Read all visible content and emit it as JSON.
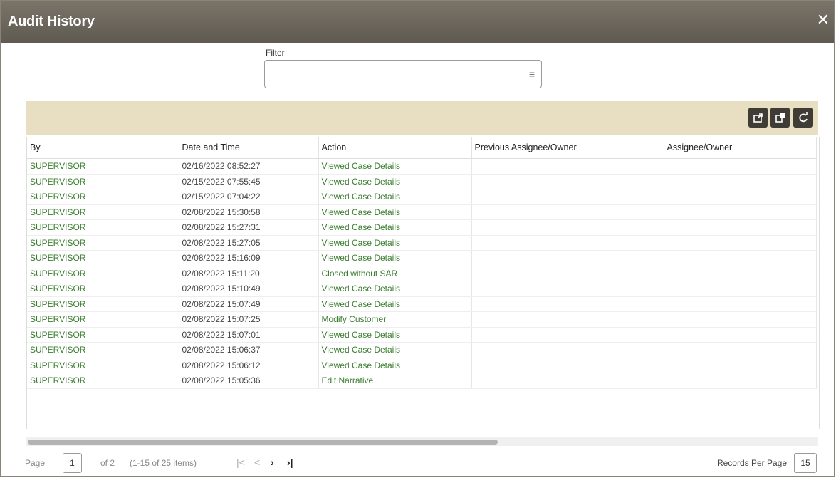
{
  "window": {
    "title": "Audit History"
  },
  "filter": {
    "label": "Filter",
    "value": ""
  },
  "toolbar": {
    "export_icon": "export-icon",
    "copy_icon": "copy-icon",
    "refresh_icon": "refresh-icon"
  },
  "table": {
    "columns": [
      "By",
      "Date and Time",
      "Action",
      "Previous Assignee/Owner",
      "Assignee/Owner"
    ],
    "rows": [
      [
        "SUPERVISOR",
        "02/16/2022 08:52:27",
        "Viewed Case Details",
        "",
        ""
      ],
      [
        "SUPERVISOR",
        "02/15/2022 07:55:45",
        "Viewed Case Details",
        "",
        ""
      ],
      [
        "SUPERVISOR",
        "02/15/2022 07:04:22",
        "Viewed Case Details",
        "",
        ""
      ],
      [
        "SUPERVISOR",
        "02/08/2022 15:30:58",
        "Viewed Case Details",
        "",
        ""
      ],
      [
        "SUPERVISOR",
        "02/08/2022 15:27:31",
        "Viewed Case Details",
        "",
        ""
      ],
      [
        "SUPERVISOR",
        "02/08/2022 15:27:05",
        "Viewed Case Details",
        "",
        ""
      ],
      [
        "SUPERVISOR",
        "02/08/2022 15:16:09",
        "Viewed Case Details",
        "",
        ""
      ],
      [
        "SUPERVISOR",
        "02/08/2022 15:11:20",
        "Closed without SAR",
        "",
        ""
      ],
      [
        "SUPERVISOR",
        "02/08/2022 15:10:49",
        "Viewed Case Details",
        "",
        ""
      ],
      [
        "SUPERVISOR",
        "02/08/2022 15:07:49",
        "Viewed Case Details",
        "",
        ""
      ],
      [
        "SUPERVISOR",
        "02/08/2022 15:07:25",
        "Modify Customer",
        "",
        ""
      ],
      [
        "SUPERVISOR",
        "02/08/2022 15:07:01",
        "Viewed Case Details",
        "",
        ""
      ],
      [
        "SUPERVISOR",
        "02/08/2022 15:06:37",
        "Viewed Case Details",
        "",
        ""
      ],
      [
        "SUPERVISOR",
        "02/08/2022 15:06:12",
        "Viewed Case Details",
        "",
        ""
      ],
      [
        "SUPERVISOR",
        "02/08/2022 15:05:36",
        "Edit Narrative",
        "",
        ""
      ]
    ]
  },
  "pager": {
    "page_label": "Page",
    "current_page": "1",
    "of_text": "of 2",
    "items_text": "(1-15 of 25 items)",
    "first_glyph": "|<",
    "prev_glyph": "<",
    "next_glyph": "›",
    "last_glyph": "›|",
    "records_label": "Records Per Page",
    "records_value": "15"
  },
  "colors": {
    "title_bg": "#6b665c",
    "toolbar_bg": "#e8dfc3",
    "link": "#3a7d2f"
  }
}
